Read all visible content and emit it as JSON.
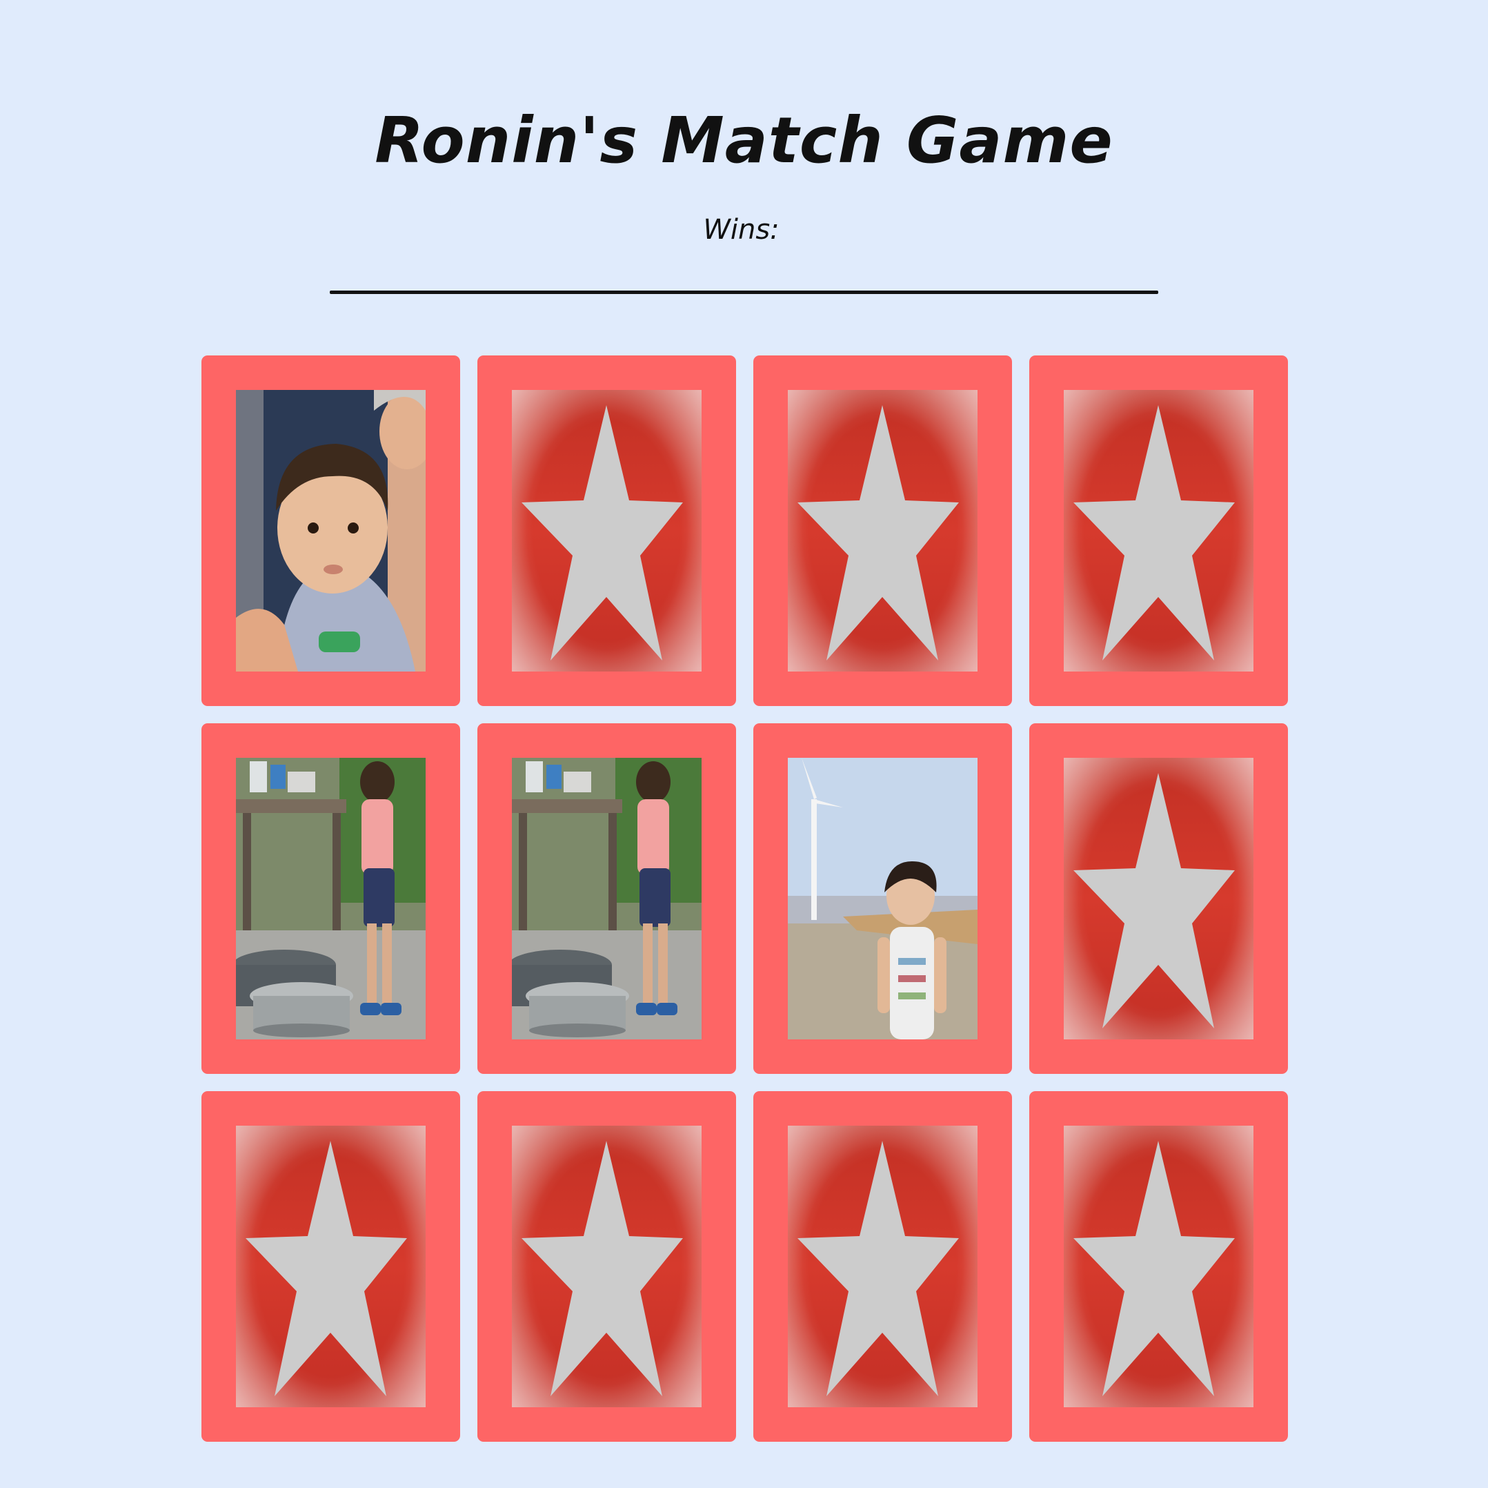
{
  "page": {
    "title": "Ronin's Match Game",
    "wins_label": "Wins:",
    "wins_count": ""
  },
  "colors": {
    "background": "#e0ebfc",
    "card_frame": "#fe6565",
    "card_back": "#c9342a",
    "star": "#cccccc"
  },
  "board": {
    "rows": 3,
    "columns": 4,
    "cards": [
      {
        "state": "face-up",
        "image": "toddler-with-grandmother-photo"
      },
      {
        "state": "face-down",
        "image": "star-card-back"
      },
      {
        "state": "face-down",
        "image": "star-card-back"
      },
      {
        "state": "face-down",
        "image": "star-card-back"
      },
      {
        "state": "face-up",
        "image": "toddler-by-water-basin-photo"
      },
      {
        "state": "face-up",
        "image": "toddler-by-water-basin-photo"
      },
      {
        "state": "face-up",
        "image": "toddler-at-windmill-beach-photo"
      },
      {
        "state": "face-down",
        "image": "star-card-back"
      },
      {
        "state": "face-down",
        "image": "star-card-back"
      },
      {
        "state": "face-down",
        "image": "star-card-back"
      },
      {
        "state": "face-down",
        "image": "star-card-back"
      },
      {
        "state": "face-down",
        "image": "star-card-back"
      }
    ]
  }
}
